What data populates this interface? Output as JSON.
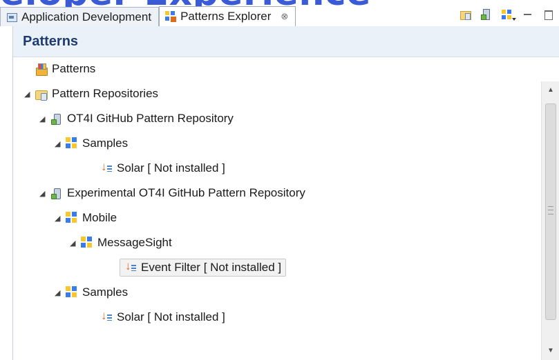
{
  "background_title": "eloper Experience",
  "tabs": [
    {
      "label": "Application Development",
      "icon": "application-development-icon",
      "active": false
    },
    {
      "label": "Patterns Explorer",
      "icon": "patterns-explorer-icon",
      "active": true,
      "close": "⊗"
    }
  ],
  "toolbar": [
    "new-repository-icon",
    "add-repository-icon",
    "view-menu-icon",
    "minimize-icon",
    "maximize-icon"
  ],
  "view": {
    "header": "Patterns"
  },
  "tree": {
    "root_patterns": "Patterns",
    "pattern_repositories": "Pattern Repositories",
    "repo1": {
      "label": "OT4I GitHub Pattern Repository",
      "samples": "Samples",
      "solar": "Solar [ Not installed ]"
    },
    "repo2": {
      "label": "Experimental OT4I GitHub Pattern Repository",
      "mobile": "Mobile",
      "messagesight": "MessageSight",
      "event_filter": "Event Filter [ Not installed ]",
      "samples": "Samples",
      "solar": "Solar [ Not installed ]"
    }
  },
  "arrows": {
    "expanded": "◢"
  }
}
